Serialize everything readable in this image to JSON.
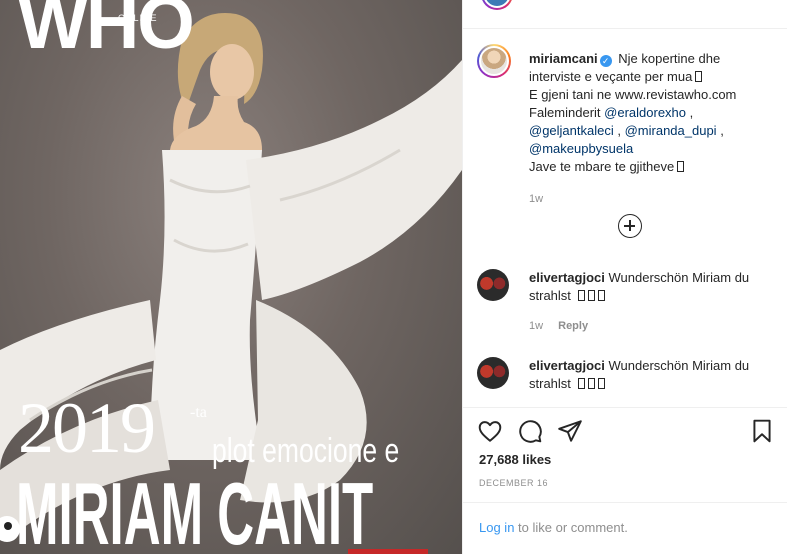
{
  "cover": {
    "logo": "WHO",
    "logo_sub": "ONLINE",
    "year": "2019",
    "year_suffix": "-ta",
    "tagline": "plot emocione e",
    "name": "MIRIAM CANIT"
  },
  "post": {
    "author": "miriamcani",
    "verified": true,
    "caption_lines": [
      "Nje kopertine dhe",
      "interviste e veçante per mua",
      "E gjeni tani ne www.revistawho.com",
      "Faleminderit"
    ],
    "mentions": [
      "@eraldorexho",
      "@geljantkaleci",
      "@miranda_dupi",
      "@makeupbysuela"
    ],
    "closing_line": "Jave te mbare te gjitheve",
    "caption_time": "1w",
    "likes": "27,688 likes",
    "date": "DECEMBER 16"
  },
  "comments": [
    {
      "user": "elivertagjoci",
      "text_line1": "Wunderschön Miriam du",
      "text_line2": "strahlst",
      "emoji_count": 3,
      "time": "1w",
      "reply_label": "Reply"
    },
    {
      "user": "elivertagjoci",
      "text_line1": "Wunderschön Miriam du",
      "text_line2": "strahlst",
      "emoji_count": 3
    }
  ],
  "footer": {
    "login_link": "Log in",
    "login_suffix": "to like or comment."
  },
  "icons": {
    "like": "heart-icon",
    "comment": "speech-bubble-icon",
    "share": "paper-plane-icon",
    "save": "bookmark-icon",
    "more_comments": "plus-circle-icon"
  },
  "colors": {
    "link": "#3897f0",
    "mention": "#003569",
    "muted": "#8e8e8e",
    "verified": "#3897f0"
  }
}
